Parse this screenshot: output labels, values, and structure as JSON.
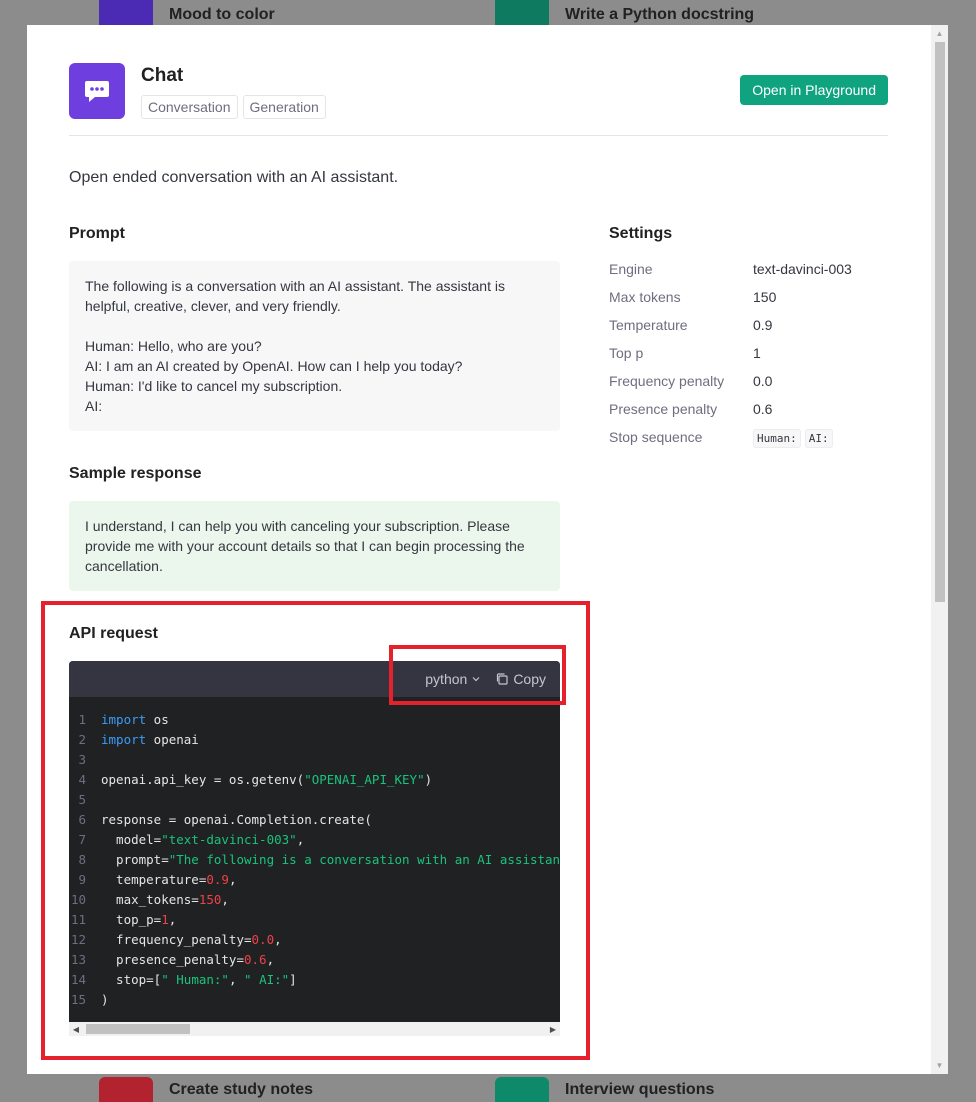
{
  "background": {
    "cards": [
      {
        "title": "Mood to color",
        "color": "#4b2bb3"
      },
      {
        "title": "Write a Python docstring",
        "color": "#0e7a5f"
      },
      {
        "title": "Create study notes",
        "color": "#b3232f"
      },
      {
        "title": "Interview questions",
        "color": "#0e8a6a"
      }
    ]
  },
  "header": {
    "title": "Chat",
    "tags": [
      "Conversation",
      "Generation"
    ],
    "playground_label": "Open in Playground"
  },
  "description": "Open ended conversation with an AI assistant.",
  "prompt": {
    "heading": "Prompt",
    "text": "The following is a conversation with an AI assistant. The assistant is helpful, creative, clever, and very friendly.\n\nHuman: Hello, who are you?\nAI: I am an AI created by OpenAI. How can I help you today?\nHuman: I'd like to cancel my subscription.\nAI:"
  },
  "sample": {
    "heading": "Sample response",
    "text": "I understand, I can help you with canceling your subscription. Please provide me with your account details so that I can begin processing the cancellation."
  },
  "api": {
    "heading": "API request",
    "language": "python",
    "copy_label": "Copy"
  },
  "settings": {
    "heading": "Settings",
    "rows": [
      {
        "key": "Engine",
        "value": "text-davinci-003"
      },
      {
        "key": "Max tokens",
        "value": "150"
      },
      {
        "key": "Temperature",
        "value": "0.9"
      },
      {
        "key": "Top p",
        "value": "1"
      },
      {
        "key": "Frequency penalty",
        "value": "0.0"
      },
      {
        "key": "Presence penalty",
        "value": "0.6"
      }
    ],
    "stop_key": "Stop sequence",
    "stop_values": [
      "Human:",
      "AI:"
    ]
  },
  "accent_color": "#10a37f",
  "highlight_color": "#e5222b"
}
